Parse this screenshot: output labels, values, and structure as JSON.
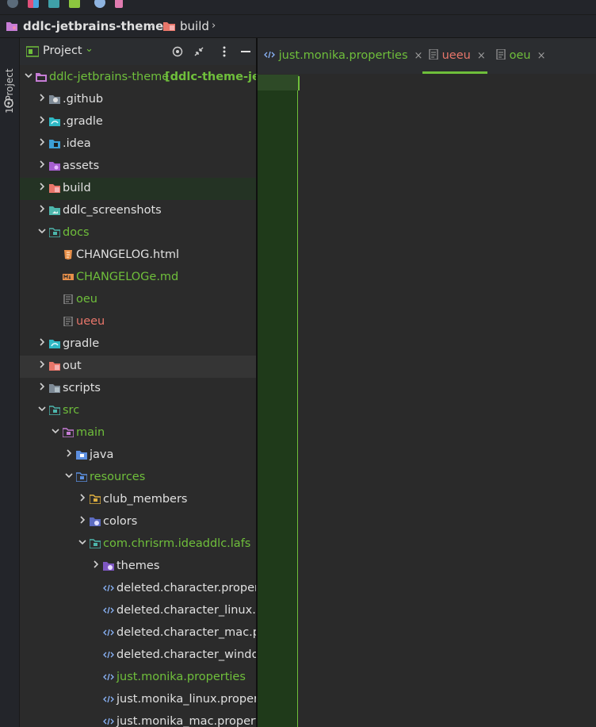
{
  "toolbar": {
    "icons": [
      "search-everywhere-icon",
      "project-structure-icon",
      "vcs-icon",
      "plugins-icon",
      "settings-icon",
      "theme-icon"
    ]
  },
  "breadcrumb": {
    "project": "ddlc-jetbrains-theme",
    "folder": "build",
    "separator": "›"
  },
  "side_stripe": {
    "project_tab": "1: Project"
  },
  "panel": {
    "title": "Project",
    "dropdown": "⌄"
  },
  "tree": {
    "root_name": "ddlc-jetbrains-theme",
    "root_module": "[ddlc-theme-jetb",
    "items": [
      ".github",
      ".gradle",
      ".idea",
      "assets",
      "build",
      "ddlc_screenshots",
      "docs",
      "CHANGELOG.html",
      "CHANGELOGe.md",
      "oeu",
      "ueeu",
      "gradle",
      "out",
      "scripts",
      "src",
      "main",
      "java",
      "resources",
      "club_members",
      "colors",
      "com.chrisrm.ideaddlc.lafs",
      "themes",
      "deleted.character.propert",
      "deleted.character_linux.p",
      "deleted.character_mac.pr",
      "deleted.character_window",
      "just.monika.properties",
      "just.monika_linux.propert",
      "just.monika_mac.properti"
    ]
  },
  "editor_tabs": [
    {
      "label": "just.monika.properties",
      "close": "×"
    },
    {
      "label": "ueeu",
      "close": "×"
    },
    {
      "label": "oeu",
      "close": "×"
    }
  ],
  "colors": {
    "accent_green": "#6fbf3b",
    "accent_red": "#e8766a",
    "selection": "#243324"
  }
}
